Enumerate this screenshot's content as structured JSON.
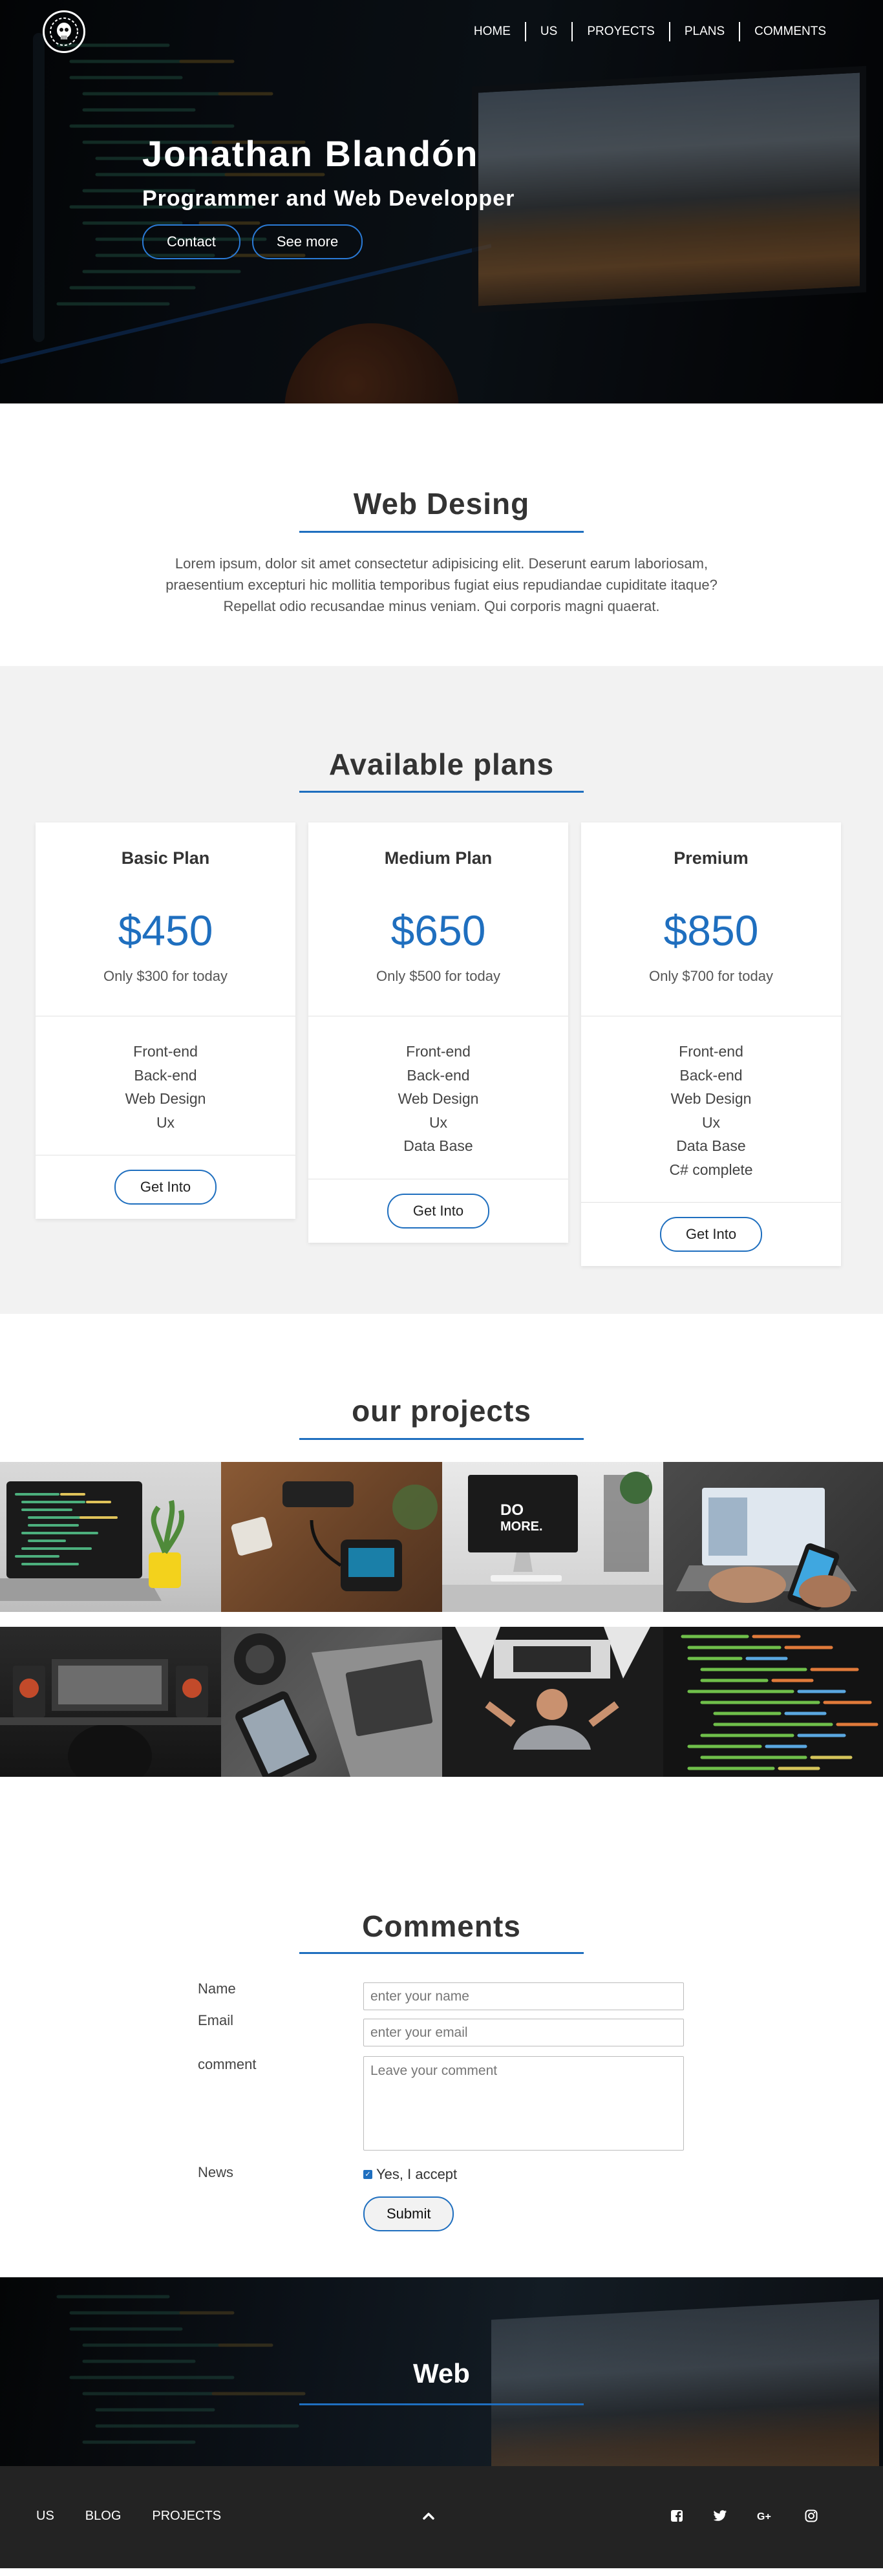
{
  "nav": {
    "logo_icon": "skull-logo-icon",
    "links": [
      "HOME",
      "US",
      "PROYECTS",
      "PLANS",
      "COMMENTS"
    ]
  },
  "hero": {
    "name": "Jonathan Blandón",
    "role": "Programmer and Web Developper",
    "buttons": [
      "Contact",
      "See more"
    ]
  },
  "web_design": {
    "title": "Web Desing",
    "text": "Lorem ipsum, dolor sit amet consectetur adipisicing elit. Deserunt earum laboriosam, praesentium excepturi hic mollitia temporibus fugiat eius repudiandae cupiditate itaque? Repellat odio recusandae minus veniam. Qui corporis magni quaerat."
  },
  "plans": {
    "title": "Available plans",
    "items": [
      {
        "name": "Basic Plan",
        "price": "$450",
        "offer": "Only $300 for today",
        "features": [
          "Front-end",
          "Back-end",
          "Web Design",
          "Ux"
        ],
        "button": "Get Into"
      },
      {
        "name": "Medium Plan",
        "price": "$650",
        "offer": "Only $500 for today",
        "features": [
          "Front-end",
          "Back-end",
          "Web Design",
          "Ux",
          "Data Base"
        ],
        "button": "Get Into"
      },
      {
        "name": "Premium",
        "price": "$850",
        "offer": "Only $700 for today",
        "features": [
          "Front-end",
          "Back-end",
          "Web Design",
          "Ux",
          "Data Base",
          "C# complete"
        ],
        "button": "Get Into"
      }
    ]
  },
  "projects": {
    "title": "our projects",
    "images": [
      "laptop-code-photo",
      "smart-device-desk-photo",
      "do-more-imac-photo",
      "laptop-phone-photo",
      "music-studio-photo",
      "phone-laptop-photo",
      "dark-desk-photo",
      "code-screen-photo"
    ]
  },
  "comments": {
    "title": "Comments",
    "labels": {
      "name": "Name",
      "email": "Email",
      "comment": "comment",
      "news": "News"
    },
    "placeholders": {
      "name": "enter your name",
      "email": "enter your email",
      "comment": "Leave your comment"
    },
    "checkbox_label": "Yes, I accept",
    "submit": "Submit"
  },
  "banner": {
    "title": "Web"
  },
  "footer": {
    "links": [
      "US",
      "BLOG",
      "PROJECTS"
    ],
    "icons": [
      "chevron-up-icon",
      "facebook-icon",
      "twitter-icon",
      "google-plus-icon",
      "instagram-icon"
    ]
  },
  "colors": {
    "accent": "#1f6fbf",
    "plans_bg": "#f2f2f2",
    "footer_bg": "#232323"
  }
}
